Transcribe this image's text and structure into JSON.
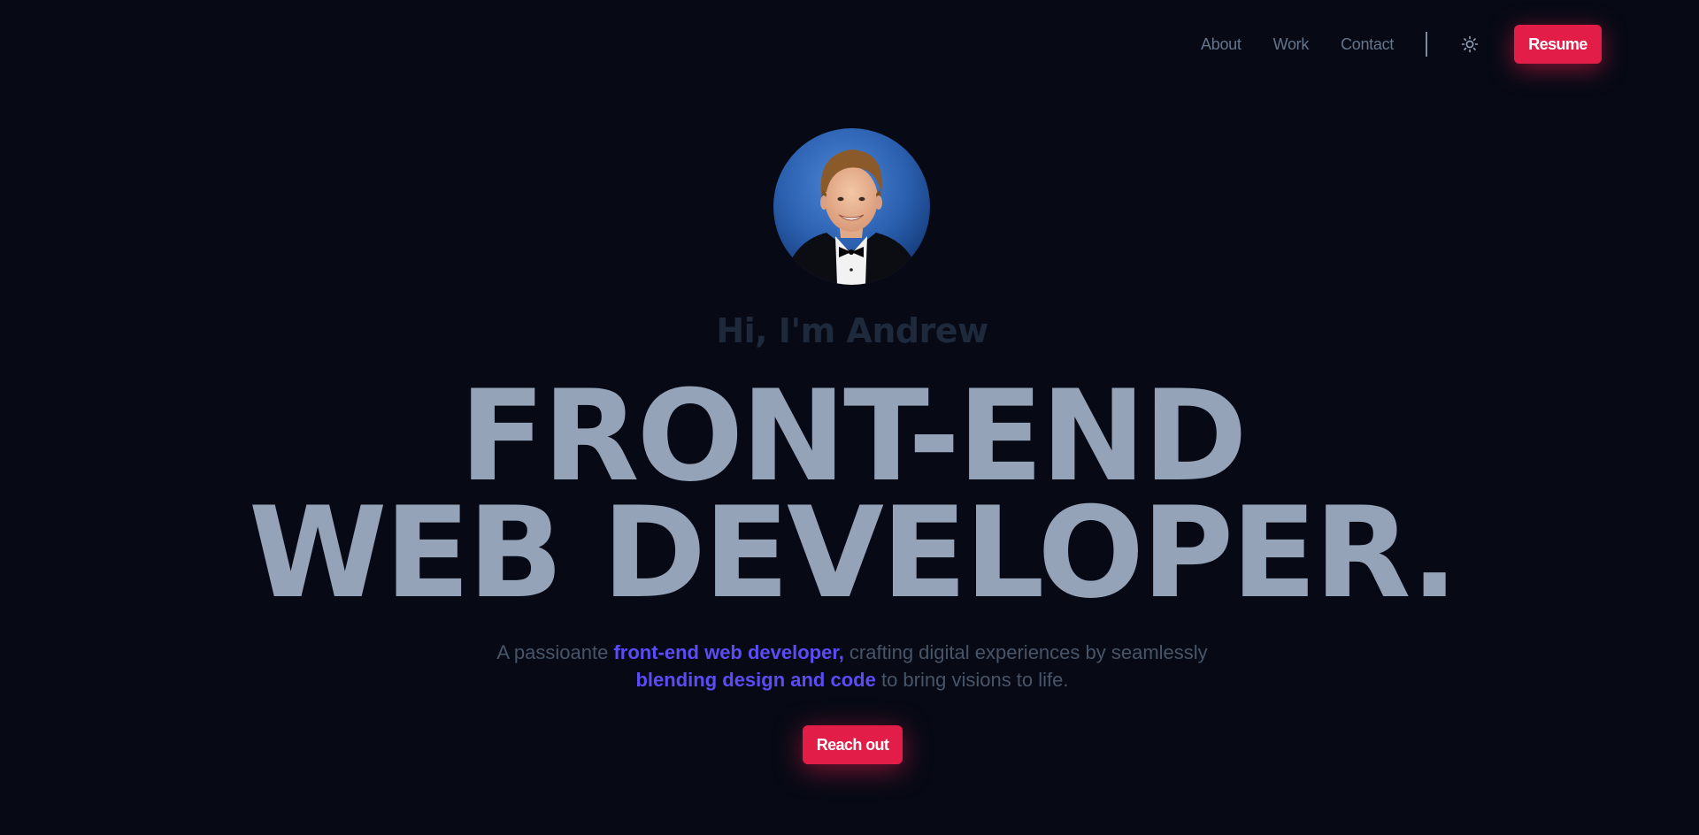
{
  "nav": {
    "links": [
      {
        "label": "About"
      },
      {
        "label": "Work"
      },
      {
        "label": "Contact"
      }
    ],
    "theme_toggle_icon": "sun-icon",
    "resume_label": "Resume"
  },
  "hero": {
    "avatar_alt": "Portrait of Andrew",
    "greeting": "Hi, I'm Andrew",
    "headline_line1": "FRONT-END",
    "headline_line2": "WEB DEVELOPER.",
    "subtitle": {
      "part1": "A passioante ",
      "highlight1": "front-end web developer,",
      "part2": " crafting digital experiences by seamlessly ",
      "highlight2": "blending design and code",
      "part3": " to bring visions to life."
    },
    "cta_label": "Reach out"
  },
  "colors": {
    "background": "#070a15",
    "accent": "#e11d48",
    "highlight": "#5b4cf5",
    "headline": "#94a3b8",
    "muted": "#64748b"
  }
}
